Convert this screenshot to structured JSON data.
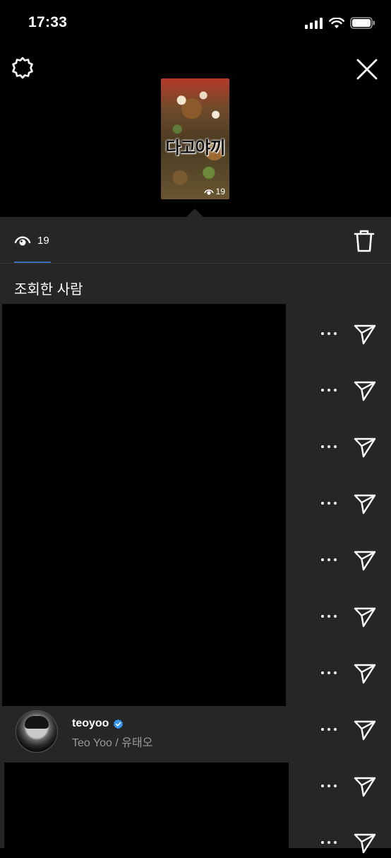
{
  "status_bar": {
    "time": "17:33"
  },
  "story": {
    "thumbnail_text": "다고야끼",
    "thumbnail_view_count": "19"
  },
  "tabs": {
    "views_count": "19"
  },
  "section": {
    "title": "조회한 사람"
  },
  "viewers": [
    {
      "username": "teoyoo",
      "full_name": "Teo Yoo / 유태오",
      "verified": true
    }
  ],
  "colors": {
    "panel": "#262626",
    "background": "#000000",
    "accent": "#3a6fb7",
    "verified": "#3897f0"
  },
  "icons": [
    "settings-icon",
    "close-icon",
    "eye-icon",
    "trash-icon",
    "more-icon",
    "send-icon",
    "verified-badge-icon"
  ]
}
